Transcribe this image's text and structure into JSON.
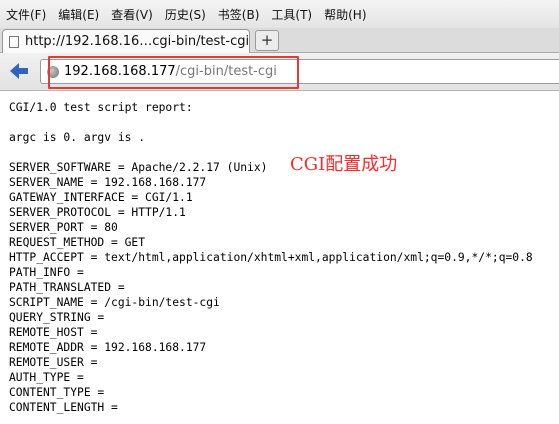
{
  "menu": [
    "文件(F)",
    "编辑(E)",
    "查看(V)",
    "历史(S)",
    "书签(B)",
    "工具(T)",
    "帮助(H)"
  ],
  "tab": {
    "title": "http://192.168.16…cgi-bin/test-cgi",
    "new_tab_symbol": "+"
  },
  "url": {
    "host": "192.168.168.177",
    "path": "/cgi-bin/test-cgi"
  },
  "annotation": "CGI配置成功",
  "page": {
    "header": "CGI/1.0 test script report:",
    "argc_line": "argc is 0. argv is .",
    "env": [
      "SERVER_SOFTWARE = Apache/2.2.17 (Unix)",
      "SERVER_NAME = 192.168.168.177",
      "GATEWAY_INTERFACE = CGI/1.1",
      "SERVER_PROTOCOL = HTTP/1.1",
      "SERVER_PORT = 80",
      "REQUEST_METHOD = GET",
      "HTTP_ACCEPT = text/html,application/xhtml+xml,application/xml;q=0.9,*/*;q=0.8",
      "PATH_INFO =",
      "PATH_TRANSLATED =",
      "SCRIPT_NAME = /cgi-bin/test-cgi",
      "QUERY_STRING =",
      "REMOTE_HOST =",
      "REMOTE_ADDR = 192.168.168.177",
      "REMOTE_USER =",
      "AUTH_TYPE =",
      "CONTENT_TYPE =",
      "CONTENT_LENGTH ="
    ]
  },
  "colors": {
    "highlight": "#e53935",
    "annotation": "#ff2a2a",
    "back_arrow": "#2f64c0"
  }
}
